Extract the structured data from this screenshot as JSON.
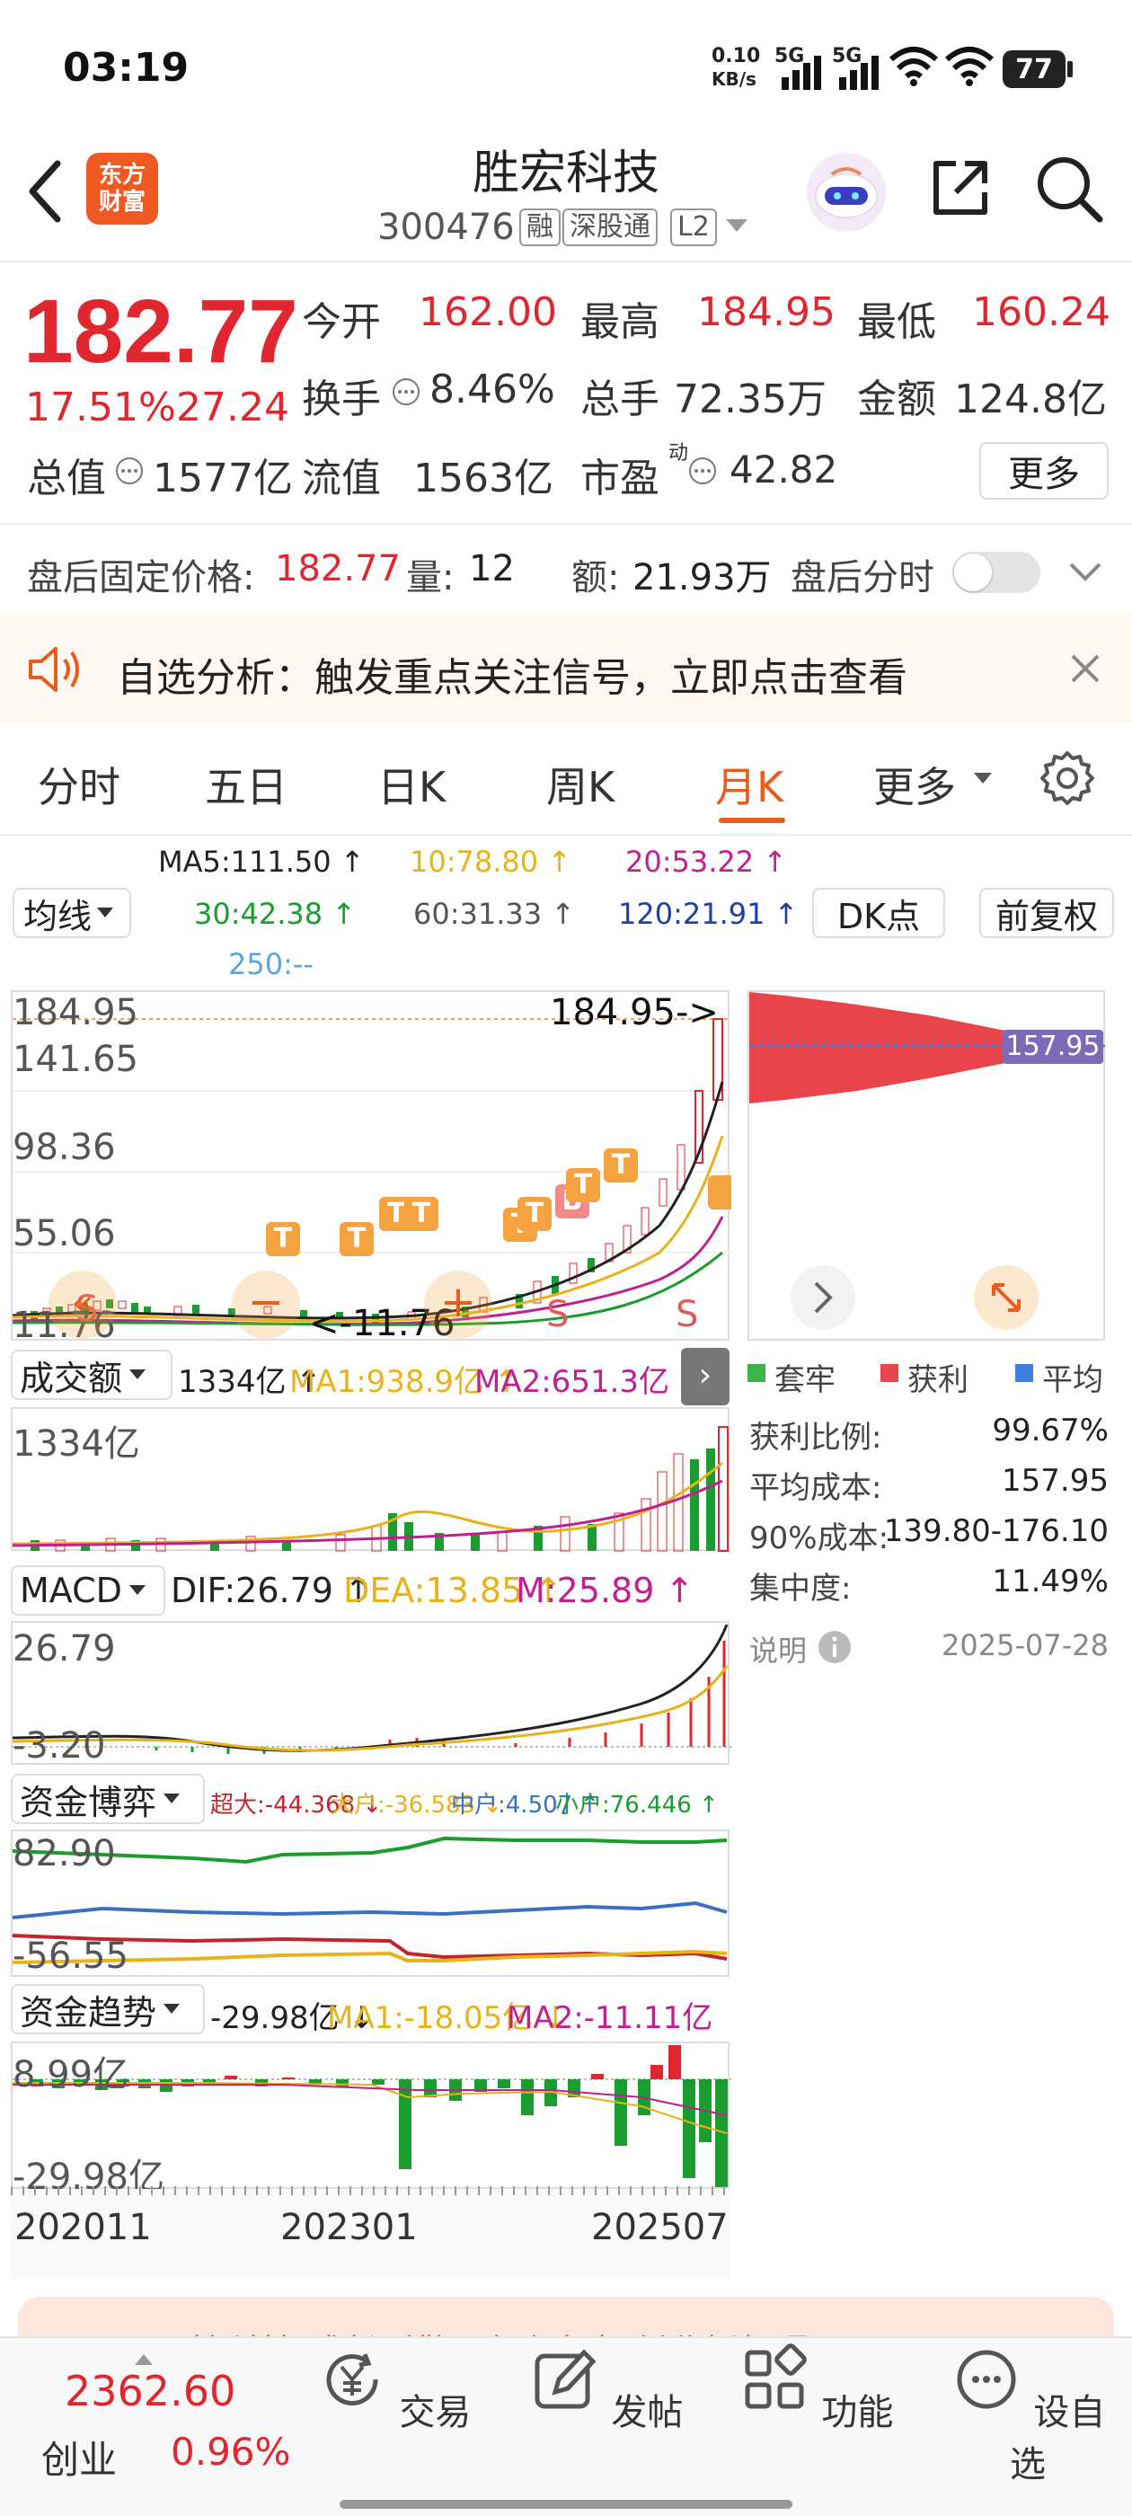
{
  "status_bar": {
    "time": "03:19",
    "net_speed_top": "0.10",
    "net_speed_bottom": "KB/s",
    "signal1": "5G",
    "signal2": "5G",
    "battery": "77"
  },
  "header": {
    "logo_line1": "东方",
    "logo_line2": "财富",
    "stock_name": "胜宏科技",
    "stock_code": "300476",
    "tags": [
      "融",
      "深股通",
      "L2"
    ]
  },
  "quote": {
    "price": "182.77",
    "change_pct": "17.51%",
    "change_amt": "27.24",
    "open_label": "今开",
    "open_value": "162.00",
    "high_label": "最高",
    "high_value": "184.95",
    "low_label": "最低",
    "low_value": "160.24",
    "turnover_label": "换手",
    "turnover_value": "8.46%",
    "volume_label": "总手",
    "volume_value": "72.35万",
    "amount_label": "金额",
    "amount_value": "124.8亿",
    "mktcap_label": "总值",
    "mktcap_value": "1577亿",
    "float_label": "流值",
    "float_value": "1563亿",
    "pe_label": "市盈",
    "pe_sup": "动",
    "pe_value": "42.82",
    "more_button": "更多"
  },
  "after_hours": {
    "price_label": "盘后固定价格:",
    "price_value": "182.77",
    "vol_label": "量:",
    "vol_value": "12",
    "amt_label": "额:",
    "amt_value": "21.93万",
    "toggle_label": "盘后分时"
  },
  "banner": {
    "text": "自选分析：触发重点关注信号，立即点击查看"
  },
  "tabs": [
    "分时",
    "五日",
    "日K",
    "周K",
    "月K",
    "更多"
  ],
  "ma_line": {
    "selector": "均线",
    "ma5": "MA5:111.50 ↑",
    "ma10": "10:78.80 ↑",
    "ma20": "20:53.22 ↑",
    "ma30": "30:42.38 ↑",
    "ma60": "60:31.33 ↑",
    "ma120": "120:21.91 ↑",
    "ma250": "250:--",
    "dk_button": "DK点",
    "fq_button": "前复权"
  },
  "kline": {
    "y_labels": [
      "184.95",
      "141.65",
      "98.36",
      "55.06",
      "11.76"
    ],
    "high_marker": "184.95->",
    "low_marker": "<-11.76",
    "markers": [
      "T",
      "T",
      "T",
      "T",
      "T",
      "T",
      "B",
      "T",
      "T",
      "S",
      "S",
      "S"
    ]
  },
  "chips": {
    "cost_tag": "157.95",
    "legend": [
      "套牢",
      "获利",
      "平均"
    ],
    "legend_colors": [
      "#3cb34a",
      "#e8444c",
      "#3b7fe0"
    ],
    "rows": [
      {
        "label": "获利比例:",
        "value": "99.67%"
      },
      {
        "label": "平均成本:",
        "value": "157.95"
      },
      {
        "label": "90%成本:",
        "value": "139.80-176.10"
      },
      {
        "label": "集中度:",
        "value": "11.49%"
      }
    ],
    "note_label": "说明",
    "date": "2025-07-28"
  },
  "volume": {
    "selector": "成交额",
    "current": "1334亿 ↑",
    "ma1": "MA1:938.9亿 ↑",
    "ma2": "MA2:651.3亿 ↑",
    "y_top": "1334亿"
  },
  "macd": {
    "selector": "MACD",
    "dif": "DIF:26.79 ↑",
    "dea": "DEA:13.85 ↑",
    "m": "M:25.89 ↑",
    "y_top": "26.79",
    "y_bottom": "-3.20"
  },
  "fund_game": {
    "selector": "资金博弈",
    "super": "超大:-44.368 ↓",
    "large": "大户:-36.583 ↓",
    "medium": "中户:4.507 ↑",
    "small": "小户:76.446 ↑",
    "y_top": "82.90",
    "y_bottom": "-56.55"
  },
  "fund_trend": {
    "selector": "资金趋势",
    "current": "-29.98亿 ↓",
    "ma1": "MA1:-18.05亿 ↓",
    "ma2": "MA2:-11.11亿 ↓",
    "y_top": "8.99亿",
    "y_bottom": "-29.98亿"
  },
  "x_axis": [
    "202011",
    "202301",
    "202507"
  ],
  "promo": {
    "text": "硬核科技·成长引擎！如何把握创业板机遇?"
  },
  "bottom_nav": {
    "index_value": "2362.60",
    "index_name": "创业",
    "index_change": "0.96%",
    "items": [
      "交易",
      "发帖",
      "功能",
      "设自选"
    ]
  },
  "colors": {
    "up": "#e0262e",
    "down": "#1a9d2e",
    "accent": "#e85d1c",
    "ma10": "#e8b21c",
    "ma20": "#c0208e",
    "ma120": "#1f3fa8",
    "ma250": "#5aa6dc"
  }
}
